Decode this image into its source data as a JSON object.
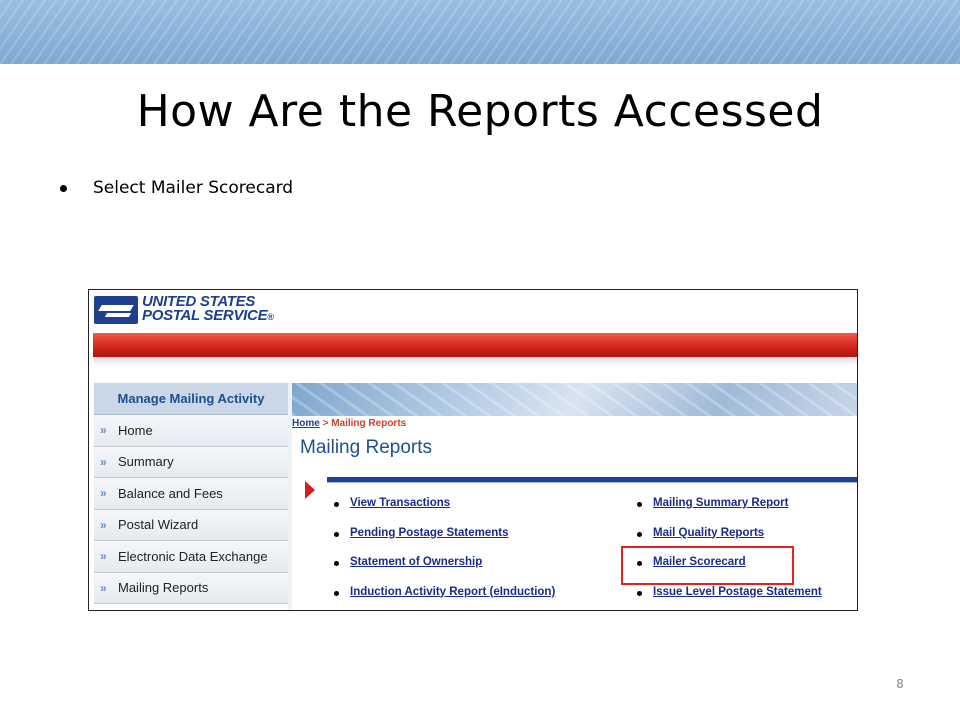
{
  "slide": {
    "title": "How Are the Reports Accessed",
    "bullet": "Select Mailer Scorecard",
    "page_number": "8"
  },
  "screenshot": {
    "logo": {
      "line1": "UNITED STATES",
      "line2": "POSTAL SERVICE",
      "mark": "®"
    },
    "nav": {
      "header": "Manage Mailing Activity",
      "items": [
        {
          "label": "Home"
        },
        {
          "label": "Summary"
        },
        {
          "label": "Balance and Fees"
        },
        {
          "label": "Postal Wizard"
        },
        {
          "label": "Electronic Data Exchange"
        },
        {
          "label": "Mailing Reports"
        }
      ],
      "arrow_glyph": "»"
    },
    "breadcrumb": {
      "home": "Home",
      "separator": " > ",
      "current": "Mailing Reports"
    },
    "heading": "Mailing Reports",
    "links_left": [
      {
        "label": "View Transactions"
      },
      {
        "label": "Pending Postage Statements"
      },
      {
        "label": "Statement of Ownership"
      },
      {
        "label": "Induction Activity Report (eInduction)"
      }
    ],
    "links_right": [
      {
        "label": "Mailing Summary Report"
      },
      {
        "label": "Mail Quality Reports"
      },
      {
        "label": "Mailer Scorecard"
      },
      {
        "label": "Issue Level Postage Statement"
      }
    ],
    "highlighted_link": "Mailer Scorecard"
  },
  "colors": {
    "header_band": "#8fb7dc",
    "usps_blue": "#1f3f8f",
    "usps_red": "#d4281e",
    "link_blue": "#1a2b8f",
    "highlight_red": "#e0251f"
  }
}
